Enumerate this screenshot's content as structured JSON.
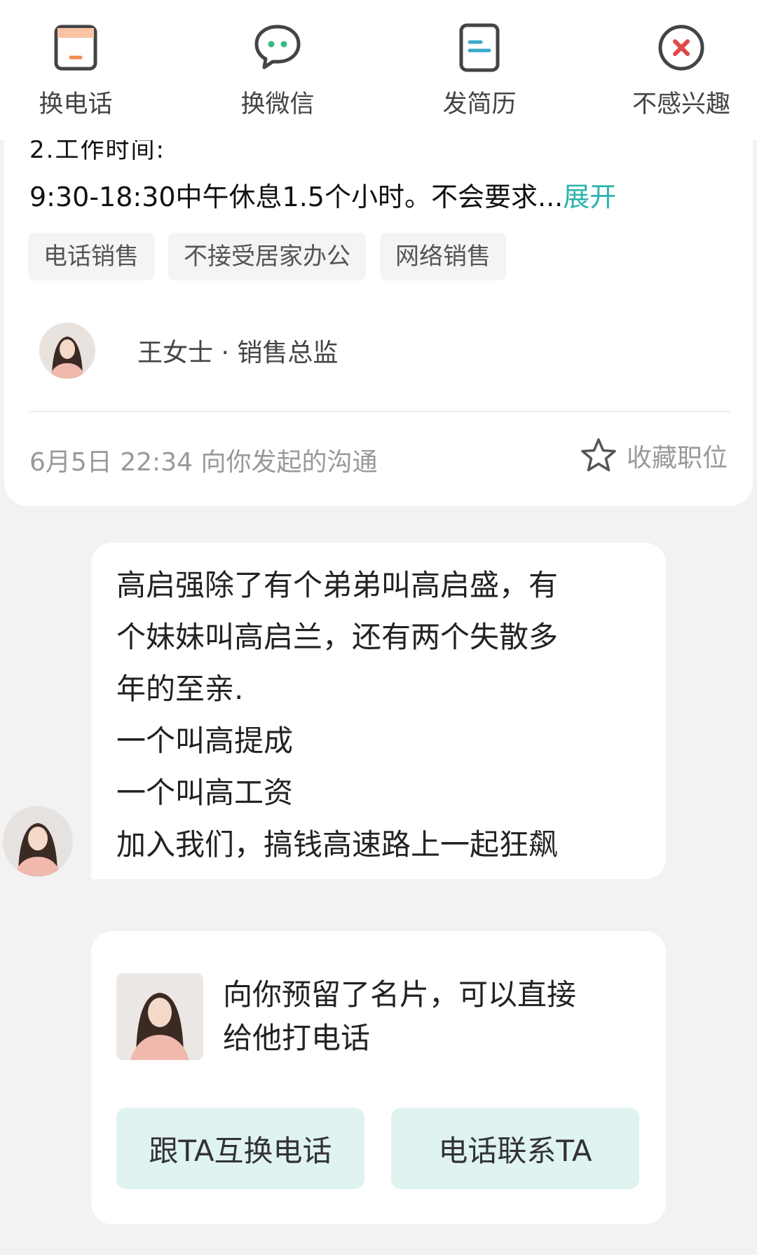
{
  "toolbar": {
    "items": [
      {
        "label": "换电话",
        "icon": "phone-card-icon"
      },
      {
        "label": "换微信",
        "icon": "wechat-icon"
      },
      {
        "label": "发简历",
        "icon": "resume-icon"
      },
      {
        "label": "不感兴趣",
        "icon": "not-interested-icon"
      }
    ],
    "colors": {
      "accent": "#f08a4b",
      "wechat": "#34b97e",
      "resume": "#3aa8c9",
      "reject": "#e04848"
    }
  },
  "job": {
    "cut_line": "2.工作时间:",
    "description": "9:30-18:30中午休息1.5个小时。不会要求...",
    "expand_label": "展开",
    "tags": [
      "电话销售",
      "不接受居家办公",
      "网络销售"
    ],
    "recruiter": "王女士 · 销售总监",
    "chat_meta": "6月5日 22:34 向你发起的沟通",
    "favorite_label": "收藏职位"
  },
  "message": {
    "lines": [
      "高启强除了有个弟弟叫高启盛，有",
      "个妹妹叫高启兰，还有两个失散多",
      "年的至亲.",
      " 一个叫高提成",
      " 一个叫高工资",
      " 加入我们，搞钱高速路上一起狂飙"
    ]
  },
  "card": {
    "text_line1": "向你预留了名片，可以直接",
    "text_line2": "给他打电话",
    "button_exchange": "跟TA互换电话",
    "button_call": "电话联系TA"
  },
  "colors": {
    "accent_teal": "#2bb3ad",
    "button_bg": "#dff3f1",
    "page_bg": "#f2f2f3"
  }
}
